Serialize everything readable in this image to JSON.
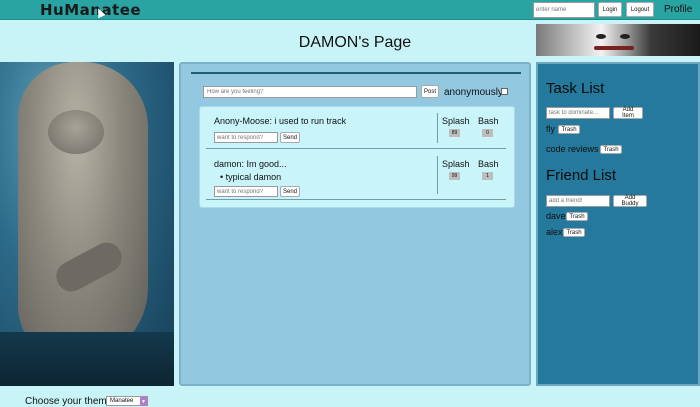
{
  "header": {
    "logo": "HuManatee",
    "name_placeholder": "enter name",
    "login_label": "Login",
    "logout_label": "Logout",
    "profile_label": "Profile"
  },
  "page": {
    "title": "DAMON's Page"
  },
  "composer": {
    "placeholder": "How are you feeling?",
    "post_label": "Post",
    "anon_label": "anonymously?"
  },
  "posts": [
    {
      "text": "Anony-Moose: i used to run track",
      "bullets": [],
      "reply_placeholder": "want to respond?",
      "send_label": "Send",
      "splash_label": "Splash",
      "splash_count": "89",
      "bash_label": "Bash",
      "bash_count": "0"
    },
    {
      "text": "damon: Im good...",
      "bullets": [
        "typical damon"
      ],
      "reply_placeholder": "want to respond?",
      "send_label": "Send",
      "splash_label": "Splash",
      "splash_count": "99",
      "bash_label": "Bash",
      "bash_count": "1"
    }
  ],
  "tasks": {
    "heading": "Task List",
    "placeholder": "task to dominate...",
    "add_label": "Add Item",
    "items": [
      {
        "label": "fly",
        "trash": "Trash"
      },
      {
        "label": "code reviews",
        "trash": "Trash"
      }
    ]
  },
  "friends": {
    "heading": "Friend List",
    "placeholder": "add a friend!",
    "add_label": "Add Buddy",
    "items": [
      {
        "label": "dave",
        "trash": "Trash"
      },
      {
        "label": "alex",
        "trash": "Trash"
      }
    ]
  },
  "footer": {
    "theme_label": "Choose your theme:",
    "theme_value": "Manatee"
  },
  "colors": {
    "topbar": "#2aa3a3",
    "background": "#c8f4f8",
    "center_panel": "#92c8e0",
    "right_panel": "#24799c"
  }
}
